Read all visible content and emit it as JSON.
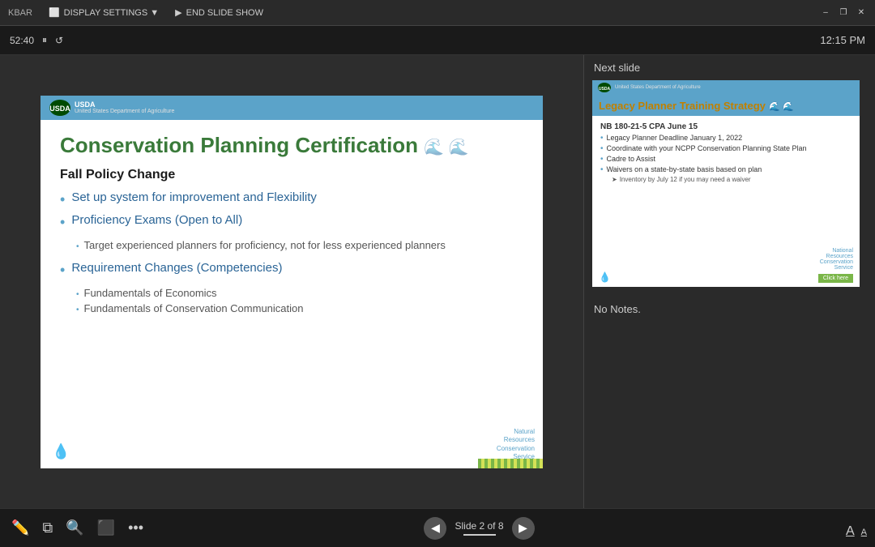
{
  "topbar": {
    "left_items": [
      "KBAR",
      "DISPLAY SETTINGS",
      "END SLIDE SHOW"
    ],
    "display_settings_label": "DISPLAY SETTINGS ▼",
    "end_slideshow_label": "END SLIDE SHOW",
    "win_minimize": "–",
    "win_restore": "❐",
    "win_close": "✕"
  },
  "controls": {
    "timer": "52:40",
    "pause_icon": "⏸",
    "refresh_icon": "↺",
    "time": "12:15 PM"
  },
  "slide": {
    "title": "Conservation Planning Certification",
    "subtitle": "Fall Policy Change",
    "bullets": [
      {
        "text": "Set up system for improvement and Flexibility",
        "sub": []
      },
      {
        "text": "Proficiency Exams (Open to All)",
        "sub": [
          "Target experienced planners for proficiency, not for less experienced planners"
        ]
      },
      {
        "text": "Requirement Changes (Competencies)",
        "sub": [
          "Fundamentals of Economics",
          "Fundamentals of Conservation Communication"
        ]
      }
    ],
    "nrcs_text": "Natural\nResources\nConservation\nService",
    "usda_text": "USDA",
    "usda_subtext": "United States Department of Agriculture"
  },
  "next_slide": {
    "label": "Next slide",
    "title": "Legacy Planner Training Strategy",
    "nb_text": "NB 180-21-5 CPA June 15",
    "bullets": [
      "Legacy Planner Deadline January 1, 2022",
      "Coordinate with your NCPP Conservation Planning State Plan",
      "Cadre to Assist",
      "Waivers on a state-by-state basis based on plan"
    ],
    "sub_bullets": [
      "Inventory by July 12 if you may need a waiver"
    ],
    "nrcs_text": "National\nResources\nConservation\nService",
    "green_btn": "Click here"
  },
  "notes": {
    "text": "No Notes."
  },
  "bottom": {
    "slide_info": "Slide 2 of 8",
    "font_a_large": "A",
    "font_a_small": "A"
  }
}
